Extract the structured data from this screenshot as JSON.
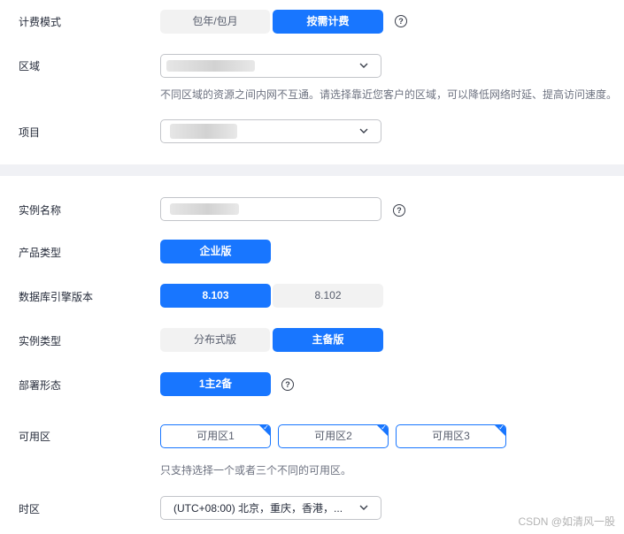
{
  "billing": {
    "label": "计费模式",
    "options": [
      "包年/包月",
      "按需计费"
    ],
    "selected": "按需计费"
  },
  "region": {
    "label": "区域",
    "hint": "不同区域的资源之间内网不互通。请选择靠近您客户的区域，可以降低网络时延、提高访问速度。"
  },
  "project": {
    "label": "项目"
  },
  "instance_name": {
    "label": "实例名称"
  },
  "product_type": {
    "label": "产品类型",
    "options": [
      "企业版"
    ],
    "selected": "企业版"
  },
  "db_engine": {
    "label": "数据库引擎版本",
    "options": [
      "8.103",
      "8.102"
    ],
    "selected": "8.103"
  },
  "instance_type": {
    "label": "实例类型",
    "options": [
      "分布式版",
      "主备版"
    ],
    "selected": "主备版"
  },
  "deployment": {
    "label": "部署形态",
    "options": [
      "1主2备"
    ],
    "selected": "1主2备"
  },
  "availability_zone": {
    "label": "可用区",
    "options": [
      "可用区1",
      "可用区2",
      "可用区3"
    ],
    "hint": "只支持选择一个或者三个不同的可用区。"
  },
  "timezone": {
    "label": "时区",
    "value": "(UTC+08:00) 北京，重庆，香港，..."
  },
  "help_glyph": "?",
  "check_glyph": "✓",
  "watermark": "CSDN @如清风一股",
  "colors": {
    "accent": "#1876ff",
    "inactive_bg": "#f2f2f2",
    "divider": "#f0f1f5",
    "border": "#c2c4c9"
  },
  "icons": {
    "help": "help-circle-icon",
    "dropdown": "chevron-down-icon",
    "check": "check-icon"
  }
}
